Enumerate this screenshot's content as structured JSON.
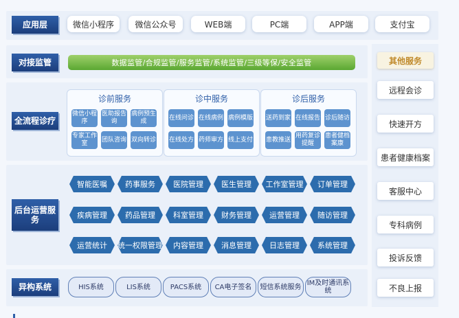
{
  "layers": {
    "app": {
      "label": "应用层",
      "items": [
        "微信小程序",
        "微信公众号",
        "WEB端",
        "PC端",
        "APP端",
        "支付宝"
      ]
    },
    "regulation": {
      "label": "对接监管",
      "bar_text": "数据监管/合规监管/服务监管/系统监管/三级等保/安全监管"
    },
    "full_process": {
      "label": "全流程诊疗",
      "groups": [
        {
          "title": "诊前服务",
          "items": [
            "微信小程序",
            "医助报告询",
            "病例预生成",
            "专家工作室",
            "团队咨询",
            "双向转诊"
          ]
        },
        {
          "title": "诊中服务",
          "items": [
            "在线问诊",
            "在线病例",
            "病例模版",
            "在线处方",
            "药师审方",
            "线上支付"
          ]
        },
        {
          "title": "诊后服务",
          "items": [
            "送药到家",
            "在线报告",
            "诊后随访",
            "患教推送",
            "用药复诊提醒",
            "患者健档案康"
          ]
        }
      ]
    },
    "backend": {
      "label": "后台运营服务",
      "items": [
        "智能医嘱",
        "药事服务",
        "医院管理",
        "医生管理",
        "工作室管理",
        "订单管理",
        "疾病管理",
        "药品管理",
        "科室管理",
        "财务管理",
        "运营管理",
        "随访管理",
        "运营统计",
        "统一权限管理",
        "内容管理",
        "消息管理",
        "日志管理",
        "系统管理"
      ]
    },
    "heterogeneous": {
      "label": "异构系统",
      "items": [
        "HIS系统",
        "LIS系统",
        "PACS系统",
        "CA电子签名",
        "短信系统服务",
        "IM及时通讯系统"
      ]
    }
  },
  "other_services": {
    "title": "其他服务",
    "items": [
      "远程会诊",
      "快速开方",
      "患者健康档案",
      "客服中心",
      "专科病例",
      "投诉反馈",
      "不良上报"
    ]
  },
  "colors": {
    "label_blue": "#2f5fa8",
    "hex_blue": "#2c6cad",
    "mini_blue": "#5d93cf",
    "green": "#5aa832",
    "gold": "#c08a2b"
  }
}
